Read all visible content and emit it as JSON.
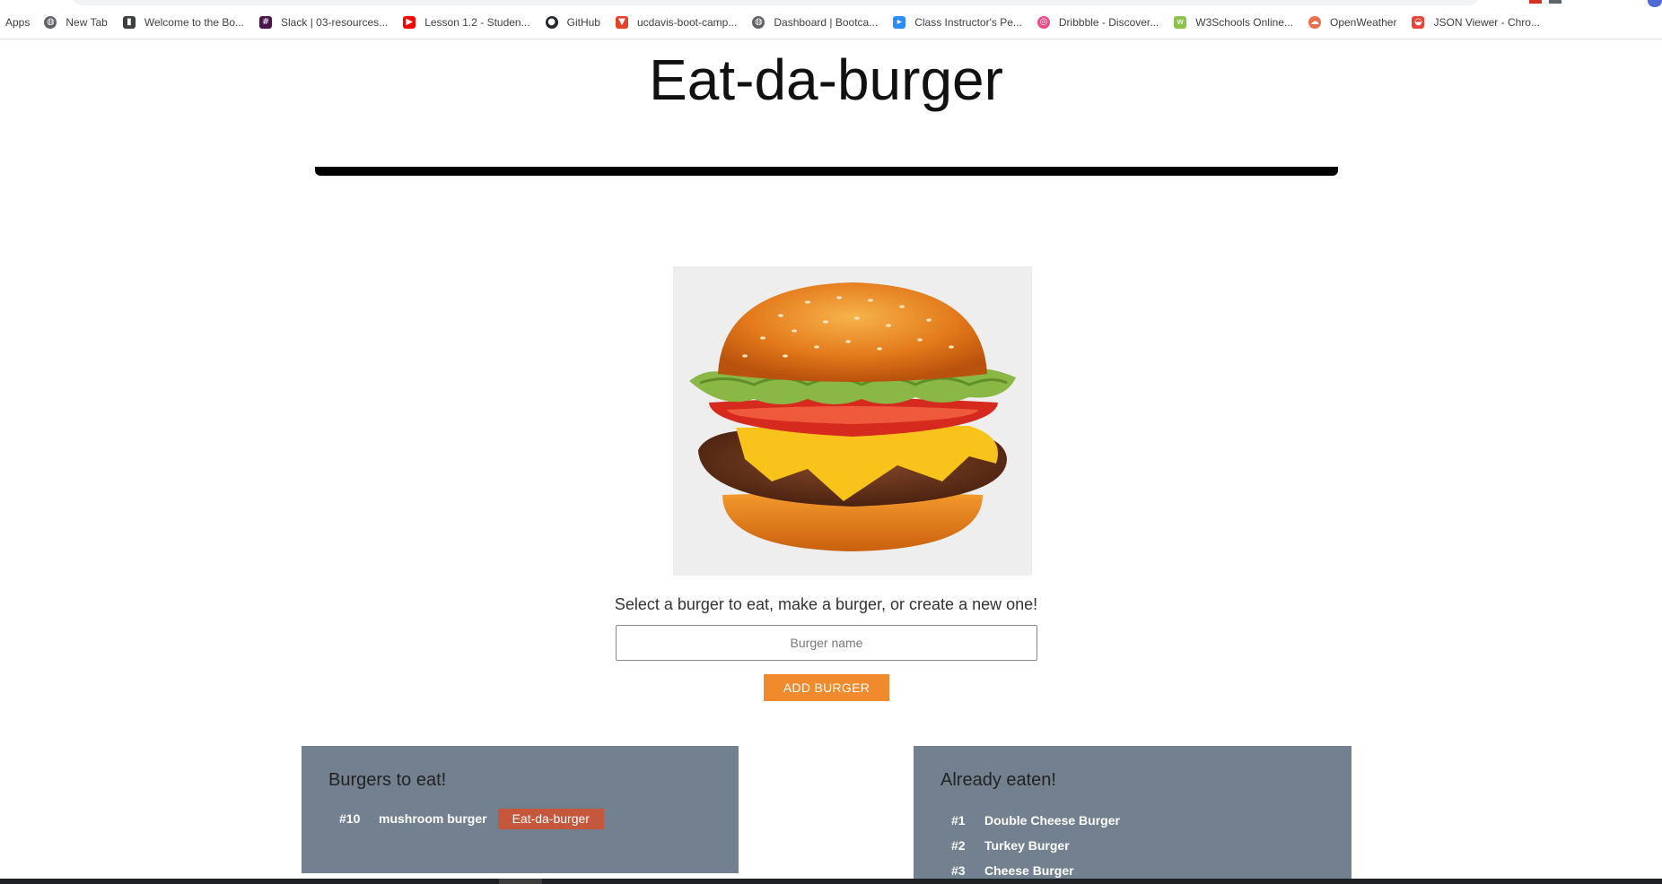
{
  "bookmarks": [
    {
      "label": "Apps",
      "icon": "apps-grid-icon"
    },
    {
      "label": "New Tab",
      "icon": "globe-icon",
      "color": "#5f6368"
    },
    {
      "label": "Welcome to the Bo...",
      "icon": "book-icon",
      "color": "#3c4043"
    },
    {
      "label": "Slack | 03-resources...",
      "icon": "slack-icon",
      "color": "#4a154b"
    },
    {
      "label": "Lesson 1.2 - Studen...",
      "icon": "youtube-icon",
      "color": "#ff0000"
    },
    {
      "label": "GitHub",
      "icon": "github-icon",
      "color": "#24292e"
    },
    {
      "label": "ucdavis-boot-camp...",
      "icon": "gitlab-icon",
      "color": "#e24329"
    },
    {
      "label": "Dashboard | Bootca...",
      "icon": "globe-icon",
      "color": "#5f6368"
    },
    {
      "label": "Class Instructor's Pe...",
      "icon": "zoom-icon",
      "color": "#2d8cff"
    },
    {
      "label": "Dribbble - Discover...",
      "icon": "dribbble-icon",
      "color": "#ea4c89"
    },
    {
      "label": "W3Schools Online...",
      "icon": "w3schools-icon",
      "color": "#8bc34a"
    },
    {
      "label": "OpenWeather",
      "icon": "openweather-icon",
      "color": "#eb6e4b"
    },
    {
      "label": "JSON Viewer - Chro...",
      "icon": "chrome-webstore-icon",
      "color": "#e8453c"
    }
  ],
  "header": {
    "title": "Eat-da-burger"
  },
  "image": {
    "alt": "burger-image"
  },
  "form": {
    "instructions": "Select a burger to eat, make a burger, or create a new one!",
    "placeholder": "Burger name",
    "value": "",
    "add_label": "ADD BURGER"
  },
  "to_eat": {
    "title": "Burgers to eat!",
    "items": [
      {
        "num": "#10",
        "name": "mushroom burger",
        "button": "Eat-da-burger"
      }
    ]
  },
  "eaten": {
    "title": "Already eaten!",
    "items": [
      {
        "num": "#1",
        "name": "Double Cheese Burger"
      },
      {
        "num": "#2",
        "name": "Turkey Burger"
      },
      {
        "num": "#3",
        "name": "Cheese Burger"
      }
    ]
  },
  "colors": {
    "panel_bg": "#72808f",
    "add_button": "#f08a2c",
    "eat_button": "#c5573d",
    "title_rule": "#000000"
  }
}
